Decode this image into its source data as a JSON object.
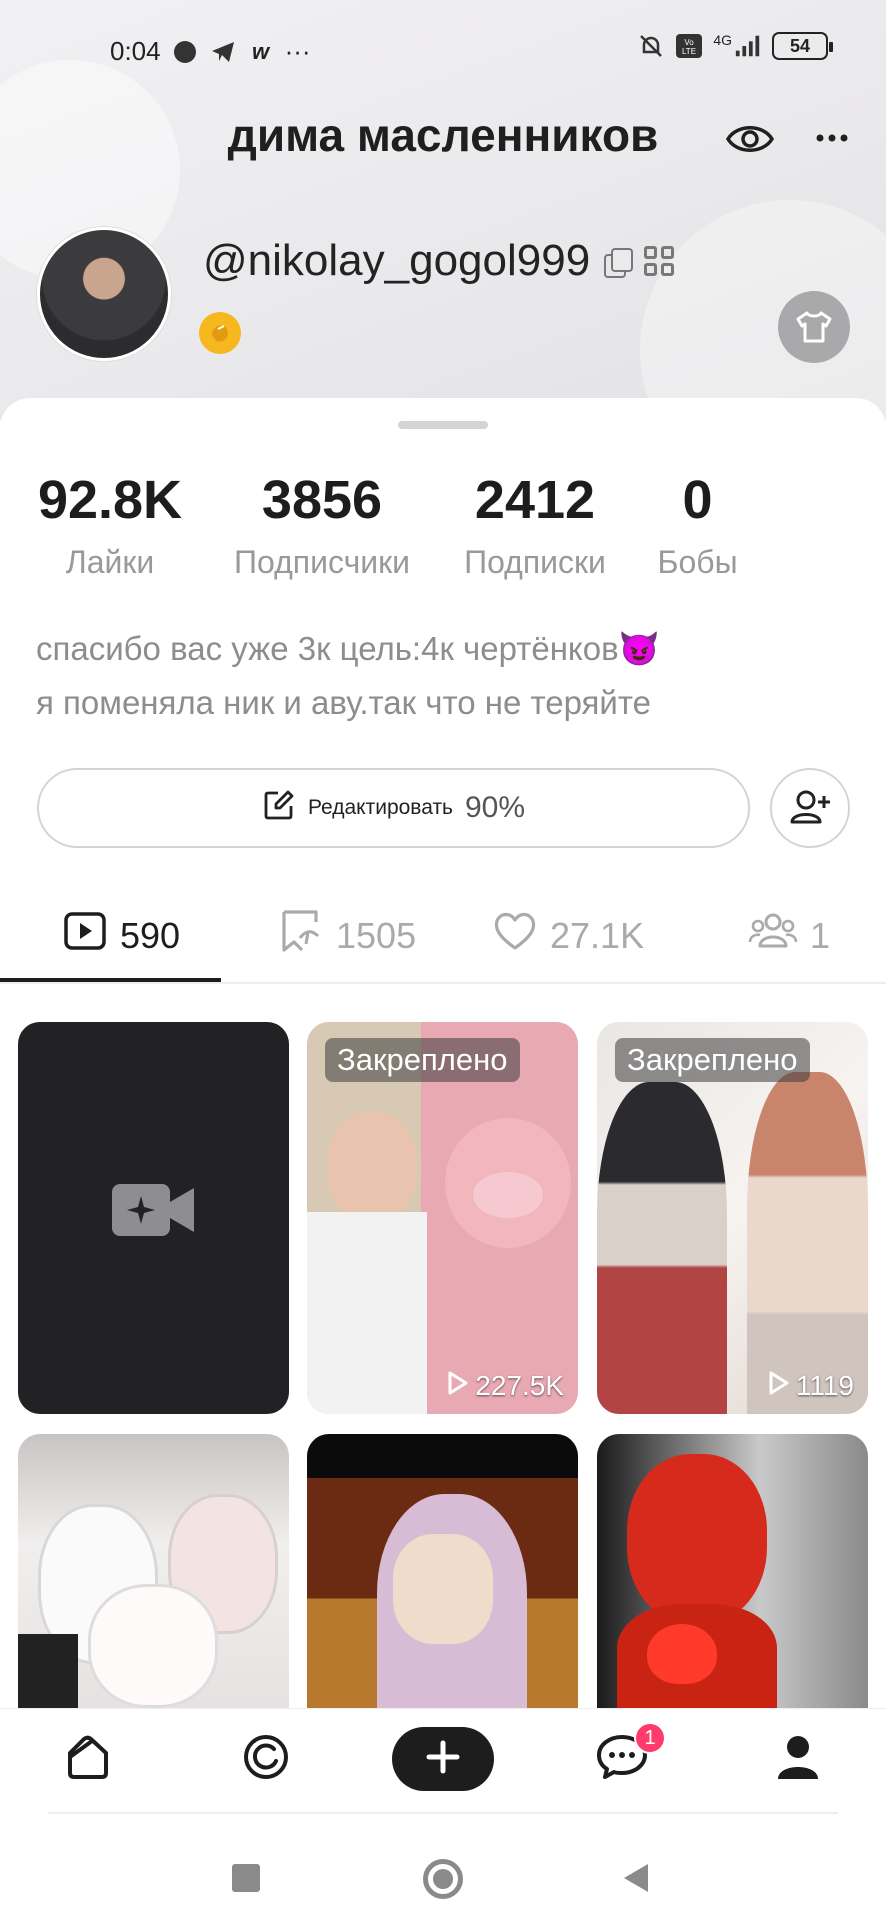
{
  "status_bar": {
    "time": "0:04",
    "dots": "···",
    "network": "4G",
    "battery": "54"
  },
  "profile": {
    "name": "дима масленников",
    "handle": "@nikolay_gogol999",
    "stats": [
      {
        "value": "92.8K",
        "label": "Лайки"
      },
      {
        "value": "3856",
        "label": "Подписчики"
      },
      {
        "value": "2412",
        "label": "Подписки"
      },
      {
        "value": "0",
        "label": "Бобы"
      }
    ],
    "bio_line1": "спасибо вас уже 3к цель:4к чертёнков😈",
    "bio_line2": "я поменяла ник и аву.так что не теряйте",
    "edit_label": "Редактировать",
    "edit_percent": "90%"
  },
  "tabs": [
    {
      "icon": "play-square-icon",
      "count": "590",
      "active": true
    },
    {
      "icon": "bookmark-icon",
      "count": "1505",
      "active": false
    },
    {
      "icon": "heart-icon",
      "count": "27.1K",
      "active": false
    },
    {
      "icon": "group-icon",
      "count": "1",
      "active": false
    }
  ],
  "videos": [
    {
      "pinned_label": "",
      "views": ""
    },
    {
      "pinned_label": "Закреплено",
      "views": "227.5K"
    },
    {
      "pinned_label": "Закреплено",
      "views": "1119"
    },
    {
      "pinned_label": "",
      "views": ""
    },
    {
      "pinned_label": "",
      "views": ""
    },
    {
      "pinned_label": "",
      "views": ""
    }
  ],
  "bottom_nav": {
    "messages_badge": "1"
  },
  "colors": {
    "accent": "#ff3b6b",
    "dark": "#1d1d1d",
    "muted": "#999999"
  }
}
